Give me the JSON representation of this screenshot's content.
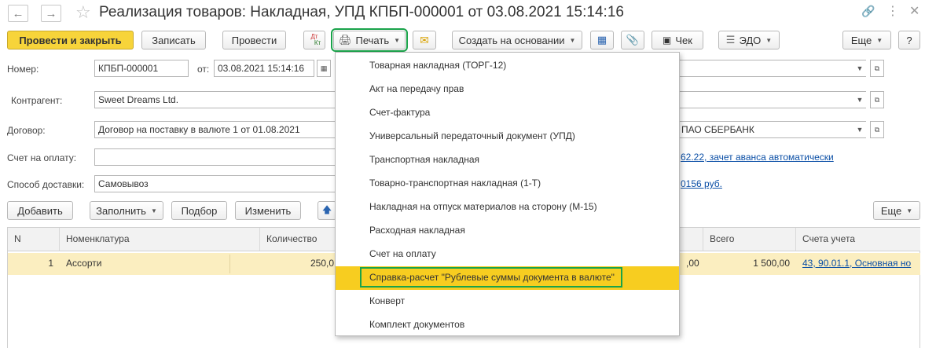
{
  "window": {
    "title": "Реализация товаров: Накладная, УПД КПБП-000001 от 03.08.2021 15:14:16"
  },
  "toolbar": {
    "post_close": "Провести и закрыть",
    "save": "Записать",
    "post": "Провести",
    "dt_kt_top": "Дт",
    "dt_kt_bottom": "Кт",
    "print": "Печать",
    "create_based": "Создать на основании",
    "receipt": "Чек",
    "edo": "ЭДО",
    "more": "Еще",
    "help": "?"
  },
  "form": {
    "number_label": "Номер:",
    "number_value": "КПБП-000001",
    "date_label": "от:",
    "date_value": "03.08.2021 15:14:16",
    "counterparty_label": "Контрагент:",
    "counterparty_value": "Sweet Dreams Ltd.",
    "contract_label": "Договор:",
    "contract_value": "Договор на поставку в валюте 1 от 01.08.2021",
    "bank_value": "ПАО СБЕРБАНК",
    "invoice_label": "Счет на оплату:",
    "invoice_link": "62.22, зачет аванса автоматически",
    "delivery_label": "Способ доставки:",
    "delivery_value": "Самовывоз",
    "amount_link": "0156 руб."
  },
  "table_toolbar": {
    "add": "Добавить",
    "fill": "Заполнить",
    "select": "Подбор",
    "change": "Изменить",
    "more": "Еще"
  },
  "table": {
    "columns": [
      "N",
      "Номенклатура",
      "Количество",
      "Всего",
      "Счета учета"
    ],
    "row": {
      "n": "1",
      "item": "Ассорти",
      "qty": "250,0",
      "price_tail": ",00",
      "total": "1 500,00",
      "accounts": "43, 90.01.1, Основная но"
    }
  },
  "print_menu": {
    "items": [
      "Товарная накладная (ТОРГ-12)",
      "Акт на передачу прав",
      "Счет-фактура",
      "Универсальный передаточный документ (УПД)",
      "Транспортная накладная",
      "Товарно-транспортная накладная (1-Т)",
      "Накладная на отпуск материалов на сторону (М-15)",
      "Расходная накладная",
      "Счет на оплату",
      "Справка-расчет \"Рублевые суммы документа в валюте\"",
      "Конверт",
      "Комплект документов"
    ],
    "selected_index": 9
  },
  "colors": {
    "primary_button": "#f7d43a",
    "highlight_outline": "#1aa34a",
    "selected_row": "#fbeec0",
    "selected_menu_item": "#f7cd20",
    "link": "#0b4fa6"
  }
}
